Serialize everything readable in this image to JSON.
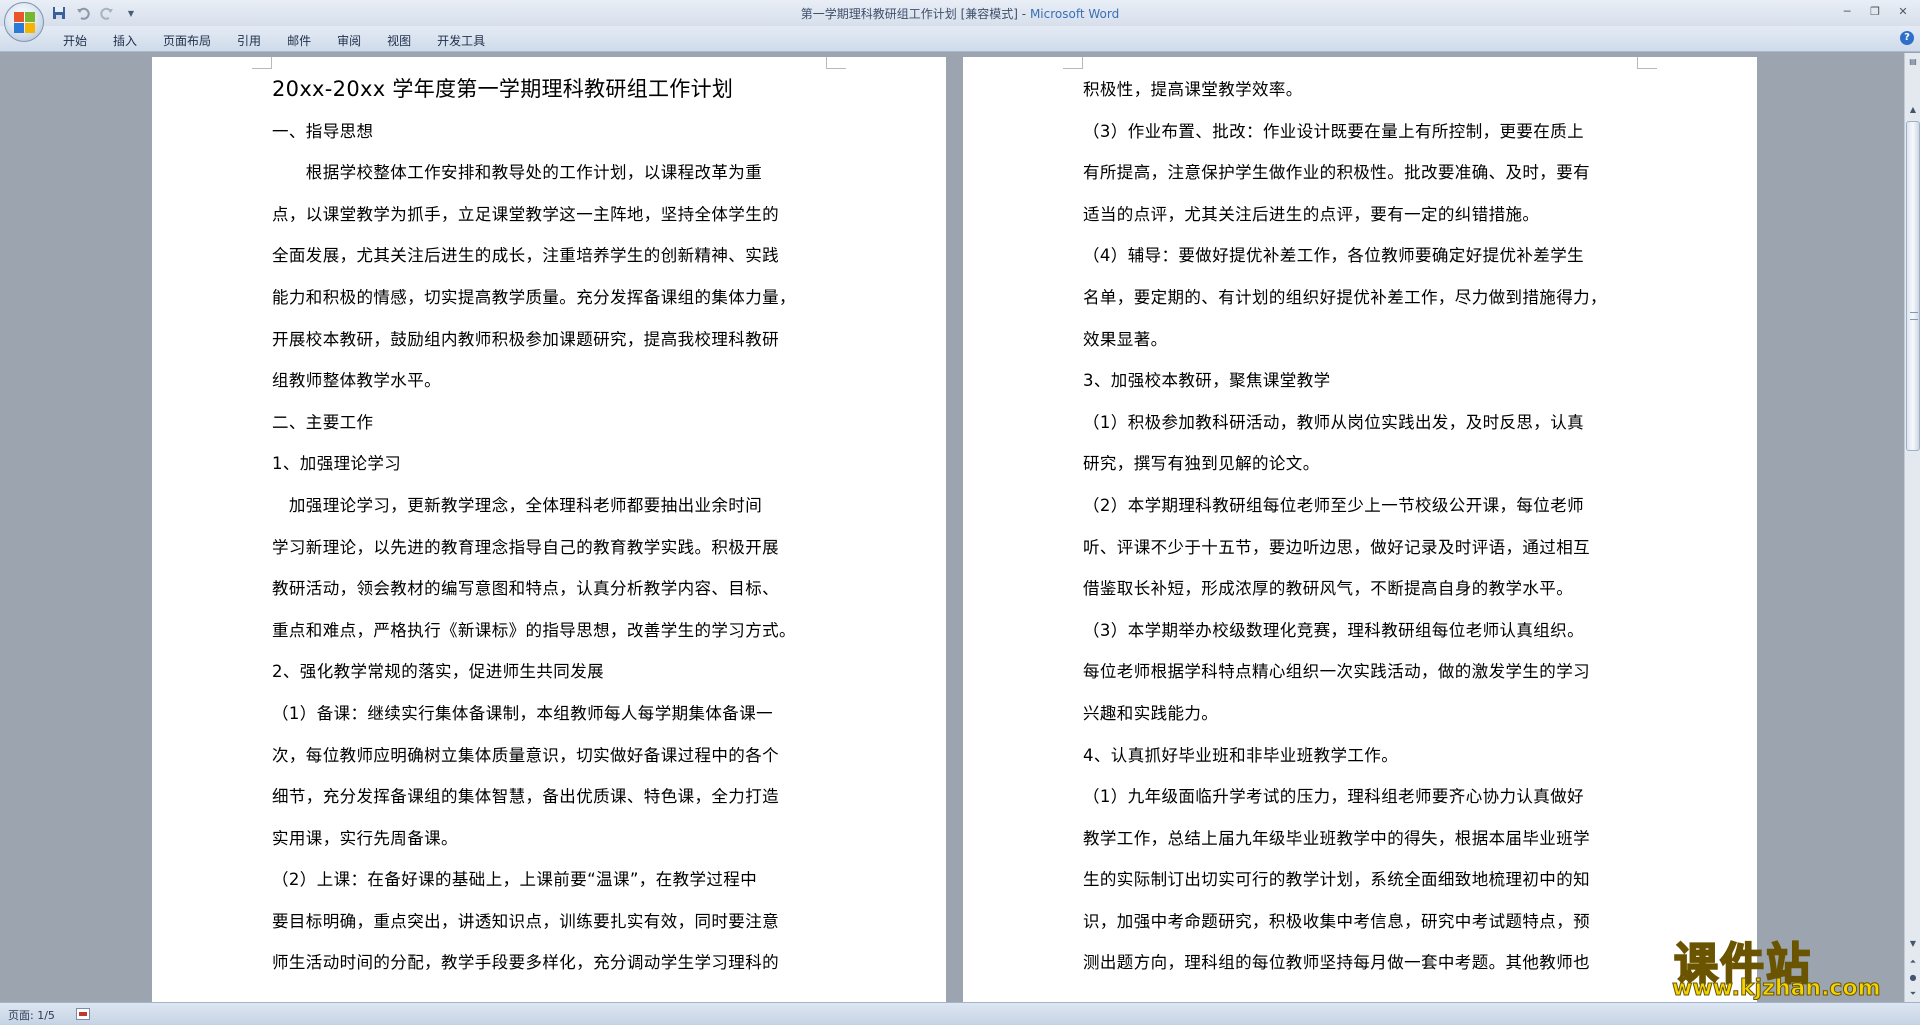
{
  "window": {
    "doc_title": "第一学期理科教研组工作计划 [兼容模式]",
    "separator": " - ",
    "app_name": "Microsoft Word"
  },
  "quick_access": {
    "icons": [
      "save-icon",
      "undo-icon",
      "redo-icon",
      "customize-dropdown-icon"
    ]
  },
  "ribbon": {
    "tabs": [
      "开始",
      "插入",
      "页面布局",
      "引用",
      "邮件",
      "审阅",
      "视图",
      "开发工具"
    ]
  },
  "page_left": {
    "lines": [
      "20xx-20xx 学年度第一学期理科教研组工作计划",
      "一、指导思想",
      "　　根据学校整体工作安排和教导处的工作计划，以课程改革为重",
      "点，以课堂教学为抓手，立足课堂教学这一主阵地，坚持全体学生的",
      "全面发展，尤其关注后进生的成长，注重培养学生的创新精神、实践",
      "能力和积极的情感，切实提高教学质量。充分发挥备课组的集体力量，",
      "开展校本教研，鼓励组内教师积极参加课题研究，提高我校理科教研",
      "组教师整体教学水平。",
      "二、主要工作",
      "1、加强理论学习",
      "　加强理论学习，更新教学理念，全体理科老师都要抽出业余时间",
      "学习新理论，以先进的教育理念指导自己的教育教学实践。积极开展",
      "教研活动，领会教材的编写意图和特点，认真分析教学内容、目标、",
      "重点和难点，严格执行《新课标》的指导思想，改善学生的学习方式。",
      "2、强化教学常规的落实，促进师生共同发展",
      "（1）备课：继续实行集体备课制，本组教师每人每学期集体备课一",
      "次，每位教师应明确树立集体质量意识，切实做好备课过程中的各个",
      "细节，充分发挥备课组的集体智慧，备出优质课、特色课，全力打造",
      "实用课，实行先周备课。",
      "（2）上课：在备好课的基础上，上课前要“温课”，在教学过程中",
      "要目标明确，重点突出，讲透知识点，训练要扎实有效，同时要注意",
      "师生活动时间的分配，教学手段要多样化，充分调动学生学习理科的"
    ]
  },
  "page_right": {
    "lines": [
      "积极性，提高课堂教学效率。",
      "（3）作业布置、批改：作业设计既要在量上有所控制，更要在质上",
      "有所提高，注意保护学生做作业的积极性。批改要准确、及时，要有",
      "适当的点评，尤其关注后进生的点评，要有一定的纠错措施。",
      "（4）辅导：要做好提优补差工作，各位教师要确定好提优补差学生",
      "名单，要定期的、有计划的组织好提优补差工作，尽力做到措施得力，",
      "效果显著。",
      "3、加强校本教研，聚焦课堂教学",
      "（1）积极参加教科研活动，教师从岗位实践出发，及时反思，认真",
      "研究，撰写有独到见解的论文。",
      "（2）本学期理科教研组每位老师至少上一节校级公开课，每位老师",
      "听、评课不少于十五节，要边听边思，做好记录及时评语，通过相互",
      "借鉴取长补短，形成浓厚的教研风气，不断提高自身的教学水平。",
      "（3）本学期举办校级数理化竞赛，理科教研组每位老师认真组织。",
      "每位老师根据学科特点精心组织一次实践活动，做的激发学生的学习",
      "兴趣和实践能力。",
      "4、认真抓好毕业班和非毕业班教学工作。",
      "（1）九年级面临升学考试的压力，理科组老师要齐心协力认真做好",
      "教学工作，总结上届九年级毕业班教学中的得失，根据本届毕业班学",
      "生的实际制订出切实可行的教学计划，系统全面细致地梳理初中的知",
      "识，加强中考命题研究，积极收集中考信息，研究中考试题特点，预",
      "测出题方向，理科组的每位教师坚持每月做一套中考题。其他教师也"
    ]
  },
  "status": {
    "page_info": "页面: 1/5"
  },
  "watermark": {
    "cn": "课件站",
    "url": "www.kjzhan.com"
  },
  "colors": {
    "app_name": "#3a6fb6",
    "workspace": "#9ba4af",
    "watermark": "#f2d500"
  }
}
